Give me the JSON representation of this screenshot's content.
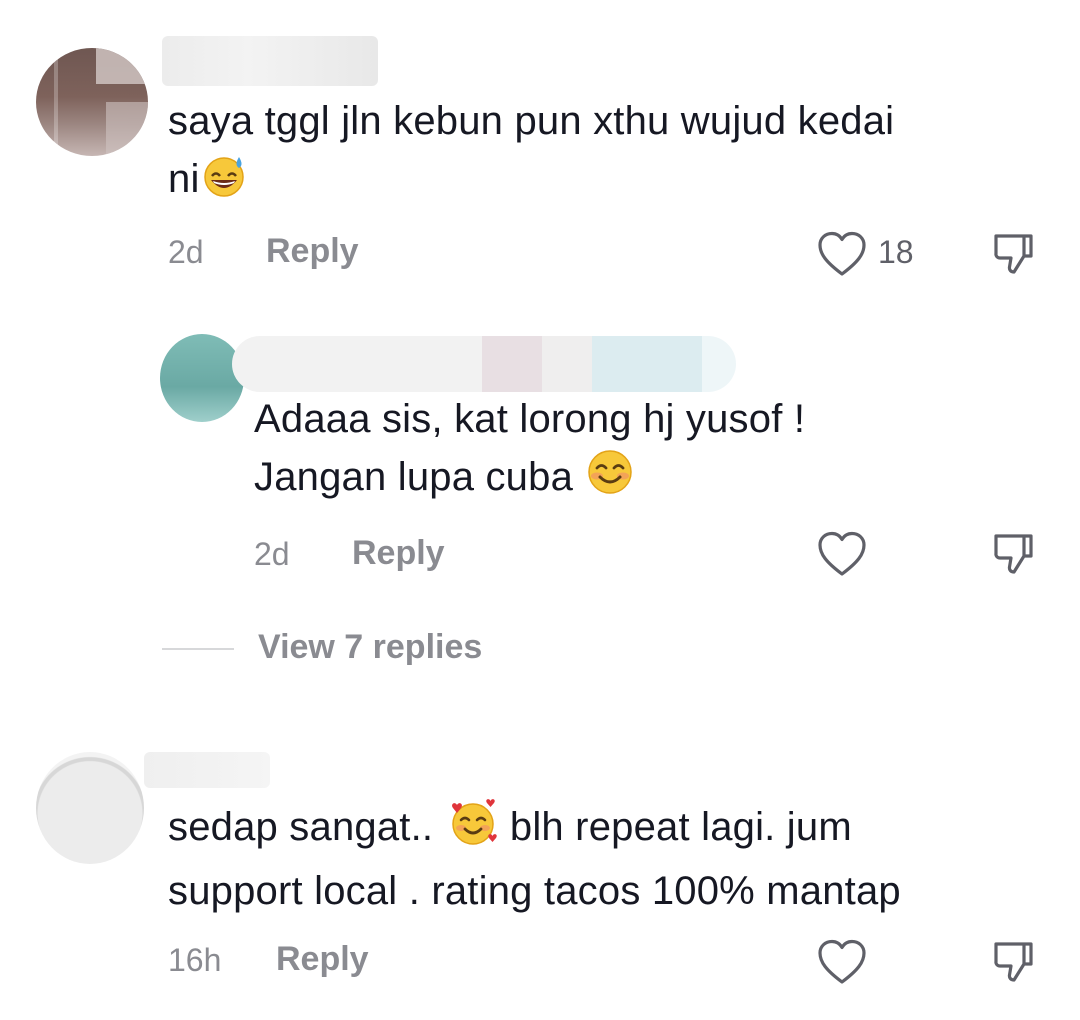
{
  "comments": [
    {
      "text_line1": "saya tggl jln kebun pun xthu wujud kedai",
      "text_line2": "ni",
      "emoji": "grinning-sweat-emoji",
      "time": "2d",
      "reply_label": "Reply",
      "likes": "18"
    },
    {
      "text_line1": "Adaaa sis, kat lorong hj yusof !",
      "text_line2": "Jangan lupa cuba",
      "emoji": "smiling-blush-emoji",
      "time": "2d",
      "reply_label": "Reply"
    },
    {
      "text_line1_a": "sedap sangat..",
      "text_line1_b": "blh repeat lagi. jum",
      "text_line2": "support local . rating tacos 100% mantap",
      "emoji": "smiling-hearts-emoji",
      "time": "16h",
      "reply_label": "Reply"
    }
  ],
  "view_replies_label": "View 7 replies",
  "colors": {
    "text": "#161823",
    "secondary": "#8a8b91",
    "icon": "#5f6068"
  },
  "icons": [
    "heart-icon",
    "dislike-icon"
  ]
}
